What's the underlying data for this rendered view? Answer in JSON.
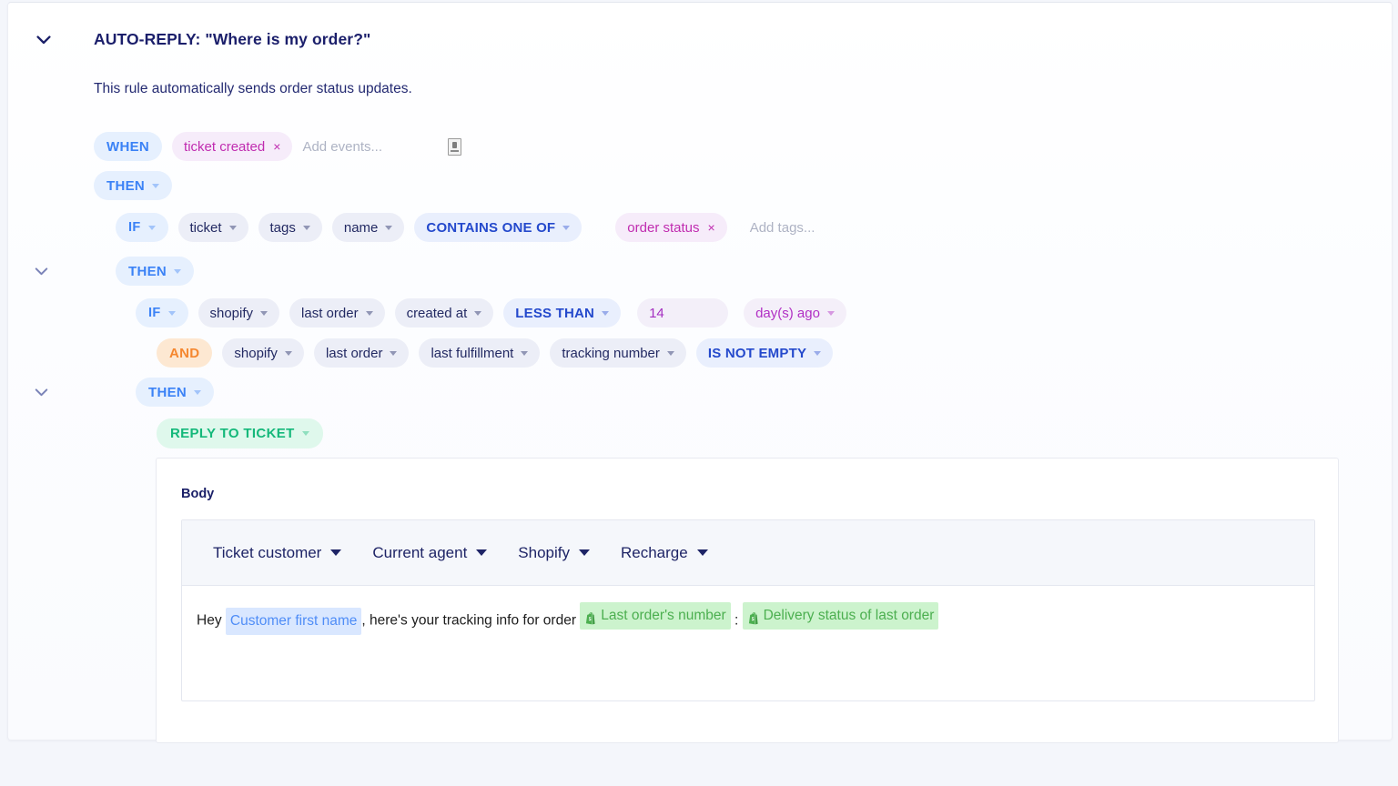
{
  "rule": {
    "title": "AUTO-REPLY: \"Where is my order?\"",
    "description": "This rule automatically sends order status updates."
  },
  "trigger_row": {
    "keyword": "WHEN",
    "event_tag": "ticket created",
    "remove_symbol": "×",
    "add_events_placeholder": "Add events...",
    "attachment_icon": "broken-image-icon"
  },
  "then_1": {
    "keyword": "THEN"
  },
  "condition_1": {
    "keyword": "IF",
    "source": "ticket",
    "field": "tags",
    "property": "name",
    "operator": "CONTAINS ONE OF",
    "tag_value": "order status",
    "remove_symbol": "×",
    "add_tags_placeholder": "Add tags..."
  },
  "then_2": {
    "keyword": "THEN"
  },
  "condition_2": {
    "keyword": "IF",
    "source": "shopify",
    "object": "last order",
    "field": "created at",
    "operator": "LESS THAN",
    "number_value": "14",
    "unit": "day(s) ago"
  },
  "condition_3": {
    "connector": "AND",
    "source": "shopify",
    "object": "last order",
    "field": "last fulfillment",
    "property": "tracking number",
    "operator": "IS NOT EMPTY"
  },
  "then_3": {
    "keyword": "THEN"
  },
  "action": {
    "label": "REPLY TO TICKET"
  },
  "body_card": {
    "label": "Body",
    "toolbar": [
      {
        "label": "Ticket customer"
      },
      {
        "label": "Current agent"
      },
      {
        "label": "Shopify"
      },
      {
        "label": "Recharge"
      }
    ],
    "message": {
      "text_1": "Hey ",
      "token_1": "Customer first name",
      "text_2": ", here's your tracking info for order ",
      "token_2": "Last order's number",
      "text_3": " : ",
      "token_3": "Delivery status of last order"
    }
  },
  "colors": {
    "page_bg": "#f4f6fb",
    "keyword_pill_bg": "#e6f0fe",
    "keyword_pill_text": "#3b82f6",
    "field_pill_bg": "#eceef7",
    "field_pill_text": "#232a63",
    "operator_pill_bg": "#e9effd",
    "operator_pill_text": "#2449cc",
    "tag_pill_bg": "#f6ecfa",
    "tag_pill_text": "#c02cb0",
    "and_pill_bg": "#fde8d2",
    "and_pill_text": "#f5872f",
    "action_pill_bg": "#dff8ec",
    "action_pill_text": "#14b87a",
    "token_blue_bg": "#d9e7ff",
    "token_blue_text": "#4f8df7",
    "token_green_bg": "#ccf3cd",
    "token_green_text": "#4caf50",
    "title_text": "#1b1f6b"
  }
}
